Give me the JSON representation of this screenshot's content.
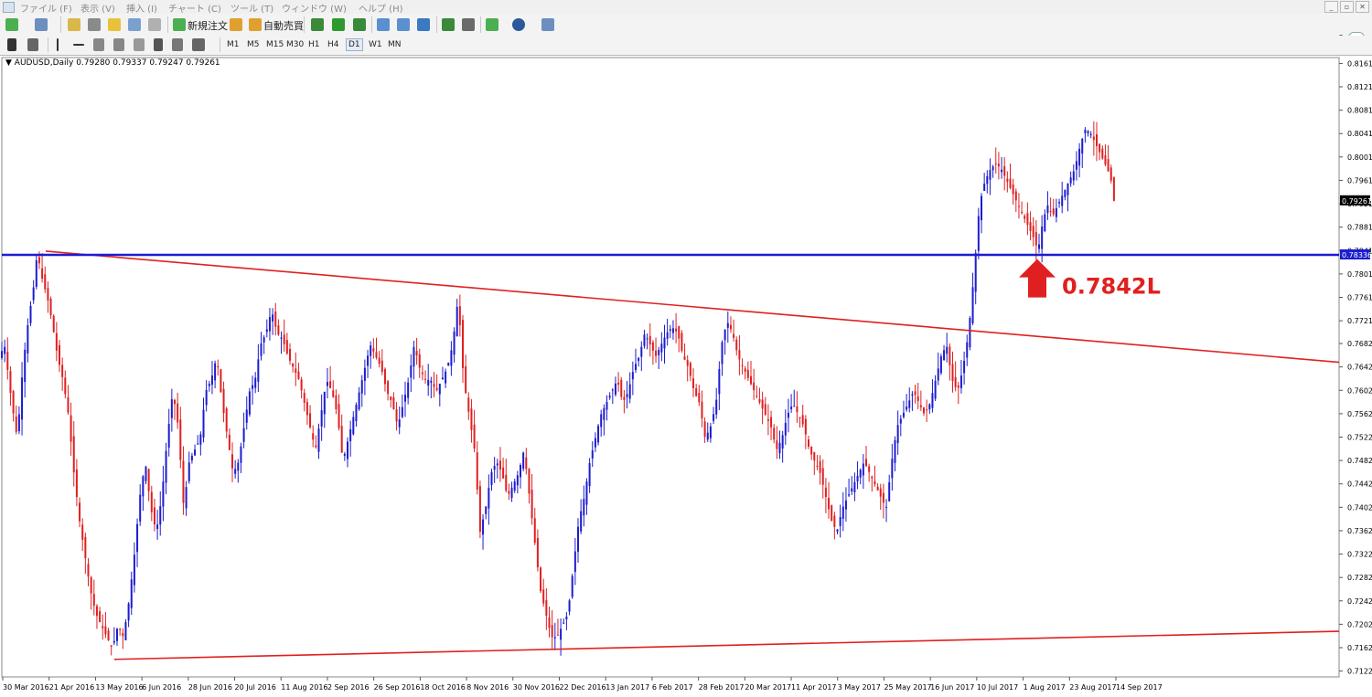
{
  "menu": {
    "items": [
      "ファイル (F)",
      "表示 (V)",
      "挿入 (I)",
      "チャート (C)",
      "ツール (T)",
      "ウィンドウ (W)",
      "ヘルプ (H)"
    ],
    "window_buttons": [
      "_",
      "▫",
      "✕"
    ]
  },
  "toolbar": {
    "new_order_label": "新規注文",
    "auto_trade_label": "自動売買"
  },
  "timeframes": [
    {
      "label": "M1",
      "active": false
    },
    {
      "label": "M5",
      "active": false
    },
    {
      "label": "M15",
      "active": false
    },
    {
      "label": "M30",
      "active": false
    },
    {
      "label": "H1",
      "active": false
    },
    {
      "label": "H4",
      "active": false
    },
    {
      "label": "D1",
      "active": true
    },
    {
      "label": "W1",
      "active": false
    },
    {
      "label": "MN",
      "active": false
    }
  ],
  "chart": {
    "header": "AUDUSD,Daily  0.79280 0.79337 0.79247 0.79261",
    "current_price_label": "0.79261",
    "line_price_label": "0.78336",
    "annotation_text": "0.7842L",
    "colors": {
      "bull": "#1c1cd0",
      "bear": "#e02020",
      "trend_line": "#e02020",
      "horizontal_line": "#1c1cd0",
      "arrow": "#e02020"
    }
  },
  "chart_data": {
    "type": "candlestick",
    "symbol": "AUDUSD",
    "timeframe": "Daily",
    "last_bar": {
      "open": 0.7928,
      "high": 0.79337,
      "low": 0.79247,
      "close": 0.79261
    },
    "y_ticks": [
      "0.81610",
      "0.81210",
      "0.80810",
      "0.80410",
      "0.80010",
      "0.79610",
      "0.79210",
      "0.78810",
      "0.78410",
      "0.78010",
      "0.77610",
      "0.77210",
      "0.76820",
      "0.76420",
      "0.76020",
      "0.75620",
      "0.75220",
      "0.74820",
      "0.74420",
      "0.74020",
      "0.73620",
      "0.73220",
      "0.72820",
      "0.72420",
      "0.72020",
      "0.71620",
      "0.71220"
    ],
    "ylim": [
      0.7112,
      0.8171
    ],
    "x_ticks": [
      "30 Mar 2016",
      "21 Apr 2016",
      "13 May 2016",
      "6 Jun 2016",
      "28 Jun 2016",
      "20 Jul 2016",
      "11 Aug 2016",
      "2 Sep 2016",
      "26 Sep 2016",
      "18 Oct 2016",
      "8 Nov 2016",
      "30 Nov 2016",
      "22 Dec 2016",
      "13 Jan 2017",
      "6 Feb 2017",
      "28 Feb 2017",
      "20 Mar 2017",
      "11 Apr 2017",
      "3 May 2017",
      "25 May 2017",
      "16 Jun 2017",
      "10 Jul 2017",
      "1 Aug 2017",
      "23 Aug 2017",
      "14 Sep 2017"
    ],
    "close_path": [
      [
        0,
        0.765
      ],
      [
        8,
        0.768
      ],
      [
        16,
        0.758
      ],
      [
        22,
        0.752
      ],
      [
        28,
        0.764
      ],
      [
        34,
        0.772
      ],
      [
        40,
        0.778
      ],
      [
        44,
        0.784
      ],
      [
        48,
        0.78
      ],
      [
        55,
        0.776
      ],
      [
        60,
        0.772
      ],
      [
        66,
        0.766
      ],
      [
        72,
        0.762
      ],
      [
        78,
        0.756
      ],
      [
        84,
        0.746
      ],
      [
        90,
        0.738
      ],
      [
        96,
        0.732
      ],
      [
        102,
        0.726
      ],
      [
        108,
        0.722
      ],
      [
        114,
        0.72
      ],
      [
        120,
        0.718
      ],
      [
        126,
        0.716
      ],
      [
        132,
        0.72
      ],
      [
        138,
        0.718
      ],
      [
        144,
        0.724
      ],
      [
        150,
        0.732
      ],
      [
        156,
        0.742
      ],
      [
        162,
        0.748
      ],
      [
        168,
        0.74
      ],
      [
        174,
        0.736
      ],
      [
        180,
        0.742
      ],
      [
        186,
        0.752
      ],
      [
        192,
        0.76
      ],
      [
        198,
        0.754
      ],
      [
        204,
        0.74
      ],
      [
        210,
        0.748
      ],
      [
        216,
        0.75
      ],
      [
        222,
        0.752
      ],
      [
        228,
        0.76
      ],
      [
        234,
        0.762
      ],
      [
        240,
        0.766
      ],
      [
        246,
        0.758
      ],
      [
        252,
        0.752
      ],
      [
        258,
        0.746
      ],
      [
        264,
        0.748
      ],
      [
        270,
        0.754
      ],
      [
        276,
        0.76
      ],
      [
        282,
        0.762
      ],
      [
        288,
        0.768
      ],
      [
        294,
        0.77
      ],
      [
        300,
        0.774
      ],
      [
        306,
        0.77
      ],
      [
        312,
        0.769
      ],
      [
        318,
        0.766
      ],
      [
        324,
        0.764
      ],
      [
        330,
        0.762
      ],
      [
        336,
        0.758
      ],
      [
        342,
        0.754
      ],
      [
        348,
        0.75
      ],
      [
        354,
        0.756
      ],
      [
        360,
        0.762
      ],
      [
        366,
        0.76
      ],
      [
        372,
        0.756
      ],
      [
        378,
        0.748
      ],
      [
        384,
        0.752
      ],
      [
        390,
        0.756
      ],
      [
        396,
        0.76
      ],
      [
        402,
        0.764
      ],
      [
        408,
        0.768
      ],
      [
        414,
        0.766
      ],
      [
        420,
        0.764
      ],
      [
        426,
        0.76
      ],
      [
        432,
        0.758
      ],
      [
        438,
        0.754
      ],
      [
        444,
        0.758
      ],
      [
        450,
        0.762
      ],
      [
        456,
        0.768
      ],
      [
        462,
        0.764
      ],
      [
        468,
        0.762
      ],
      [
        474,
        0.762
      ],
      [
        480,
        0.76
      ],
      [
        486,
        0.762
      ],
      [
        492,
        0.764
      ],
      [
        498,
        0.768
      ],
      [
        504,
        0.776
      ],
      [
        510,
        0.762
      ],
      [
        516,
        0.756
      ],
      [
        522,
        0.75
      ],
      [
        528,
        0.736
      ],
      [
        534,
        0.74
      ],
      [
        540,
        0.746
      ],
      [
        546,
        0.748
      ],
      [
        552,
        0.746
      ],
      [
        558,
        0.742
      ],
      [
        564,
        0.744
      ],
      [
        570,
        0.746
      ],
      [
        576,
        0.75
      ],
      [
        582,
        0.742
      ],
      [
        588,
        0.734
      ],
      [
        594,
        0.726
      ],
      [
        600,
        0.722
      ],
      [
        606,
        0.718
      ],
      [
        612,
        0.718
      ],
      [
        618,
        0.72
      ],
      [
        624,
        0.722
      ],
      [
        630,
        0.73
      ],
      [
        636,
        0.738
      ],
      [
        642,
        0.742
      ],
      [
        648,
        0.748
      ],
      [
        654,
        0.752
      ],
      [
        660,
        0.756
      ],
      [
        666,
        0.758
      ],
      [
        672,
        0.76
      ],
      [
        678,
        0.762
      ],
      [
        684,
        0.758
      ],
      [
        690,
        0.76
      ],
      [
        696,
        0.764
      ],
      [
        702,
        0.766
      ],
      [
        708,
        0.77
      ],
      [
        714,
        0.768
      ],
      [
        720,
        0.766
      ],
      [
        726,
        0.768
      ],
      [
        732,
        0.77
      ],
      [
        738,
        0.771
      ],
      [
        744,
        0.77
      ],
      [
        750,
        0.766
      ],
      [
        756,
        0.764
      ],
      [
        762,
        0.76
      ],
      [
        768,
        0.758
      ],
      [
        774,
        0.752
      ],
      [
        780,
        0.754
      ],
      [
        786,
        0.758
      ],
      [
        792,
        0.768
      ],
      [
        798,
        0.772
      ],
      [
        804,
        0.77
      ],
      [
        810,
        0.766
      ],
      [
        816,
        0.764
      ],
      [
        822,
        0.762
      ],
      [
        828,
        0.76
      ],
      [
        834,
        0.758
      ],
      [
        840,
        0.756
      ],
      [
        846,
        0.754
      ],
      [
        852,
        0.75
      ],
      [
        858,
        0.752
      ],
      [
        864,
        0.756
      ],
      [
        870,
        0.758
      ],
      [
        876,
        0.756
      ],
      [
        882,
        0.754
      ],
      [
        888,
        0.75
      ],
      [
        894,
        0.748
      ],
      [
        900,
        0.746
      ],
      [
        906,
        0.742
      ],
      [
        912,
        0.738
      ],
      [
        918,
        0.736
      ],
      [
        924,
        0.74
      ],
      [
        930,
        0.742
      ],
      [
        936,
        0.744
      ],
      [
        942,
        0.746
      ],
      [
        948,
        0.748
      ],
      [
        954,
        0.746
      ],
      [
        960,
        0.744
      ],
      [
        966,
        0.742
      ],
      [
        972,
        0.74
      ],
      [
        978,
        0.748
      ],
      [
        984,
        0.754
      ],
      [
        990,
        0.756
      ],
      [
        996,
        0.758
      ],
      [
        1002,
        0.76
      ],
      [
        1008,
        0.758
      ],
      [
        1014,
        0.756
      ],
      [
        1020,
        0.758
      ],
      [
        1026,
        0.762
      ],
      [
        1032,
        0.766
      ],
      [
        1038,
        0.768
      ],
      [
        1044,
        0.762
      ],
      [
        1050,
        0.76
      ],
      [
        1056,
        0.764
      ],
      [
        1062,
        0.77
      ],
      [
        1068,
        0.78
      ],
      [
        1074,
        0.792
      ],
      [
        1080,
        0.796
      ],
      [
        1086,
        0.798
      ],
      [
        1092,
        0.799
      ],
      [
        1098,
        0.798
      ],
      [
        1104,
        0.796
      ],
      [
        1110,
        0.794
      ],
      [
        1116,
        0.792
      ],
      [
        1122,
        0.79
      ],
      [
        1128,
        0.788
      ],
      [
        1134,
        0.786
      ],
      [
        1138,
        0.784
      ],
      [
        1142,
        0.788
      ],
      [
        1148,
        0.792
      ],
      [
        1154,
        0.79
      ],
      [
        1160,
        0.792
      ],
      [
        1166,
        0.794
      ],
      [
        1172,
        0.796
      ],
      [
        1178,
        0.798
      ],
      [
        1184,
        0.802
      ],
      [
        1190,
        0.805
      ],
      [
        1196,
        0.804
      ],
      [
        1202,
        0.802
      ],
      [
        1208,
        0.8
      ],
      [
        1214,
        0.798
      ],
      [
        1218,
        0.796
      ],
      [
        1221,
        0.7926
      ]
    ],
    "trend_lines": [
      {
        "name": "upper-resistance",
        "from": [
          50,
          0.784
        ],
        "to": [
          1464,
          0.765
        ]
      },
      {
        "name": "lower-support",
        "from": [
          125,
          0.7142
        ],
        "to": [
          1464,
          0.719
        ]
      }
    ],
    "horizontal_line": {
      "value": 0.78336
    },
    "annotation": {
      "text": "0.7842L",
      "value": 0.7842
    }
  }
}
